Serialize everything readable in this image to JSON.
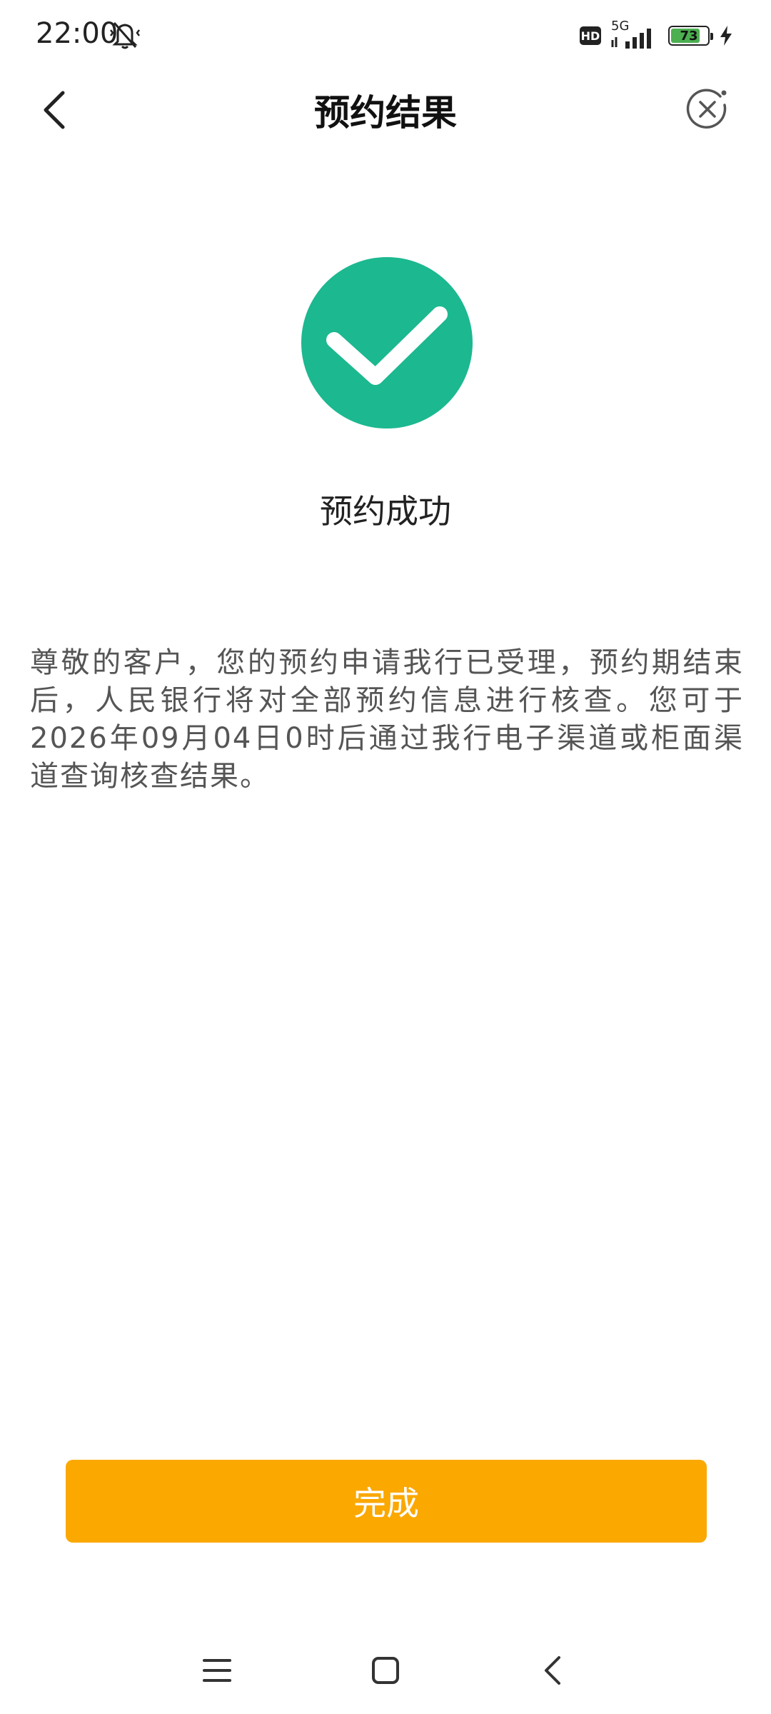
{
  "status_bar": {
    "time": "22:00",
    "hd": "HD",
    "network": "5G",
    "battery": "73",
    "icons": [
      "mute-icon",
      "signal-icon",
      "battery-icon",
      "charging-icon"
    ]
  },
  "header": {
    "title": "预约结果",
    "icons": [
      "back-arrow-icon",
      "close-circle-icon"
    ]
  },
  "result": {
    "status_text": "预约成功",
    "icon": "check-circle-icon",
    "accent_color": "#1cb890",
    "message": "尊敬的客户，您的预约申请我行已受理，预约期结束后，人民银行将对全部预约信息进行核查。您可于2026年09月04日0时后通过我行电子渠道或柜面渠道查询核查结果。"
  },
  "actions": {
    "done_label": "完成",
    "done_color": "#fba800"
  },
  "nav_bar": {
    "icons": [
      "menu-icon",
      "home-icon",
      "back-icon"
    ]
  }
}
